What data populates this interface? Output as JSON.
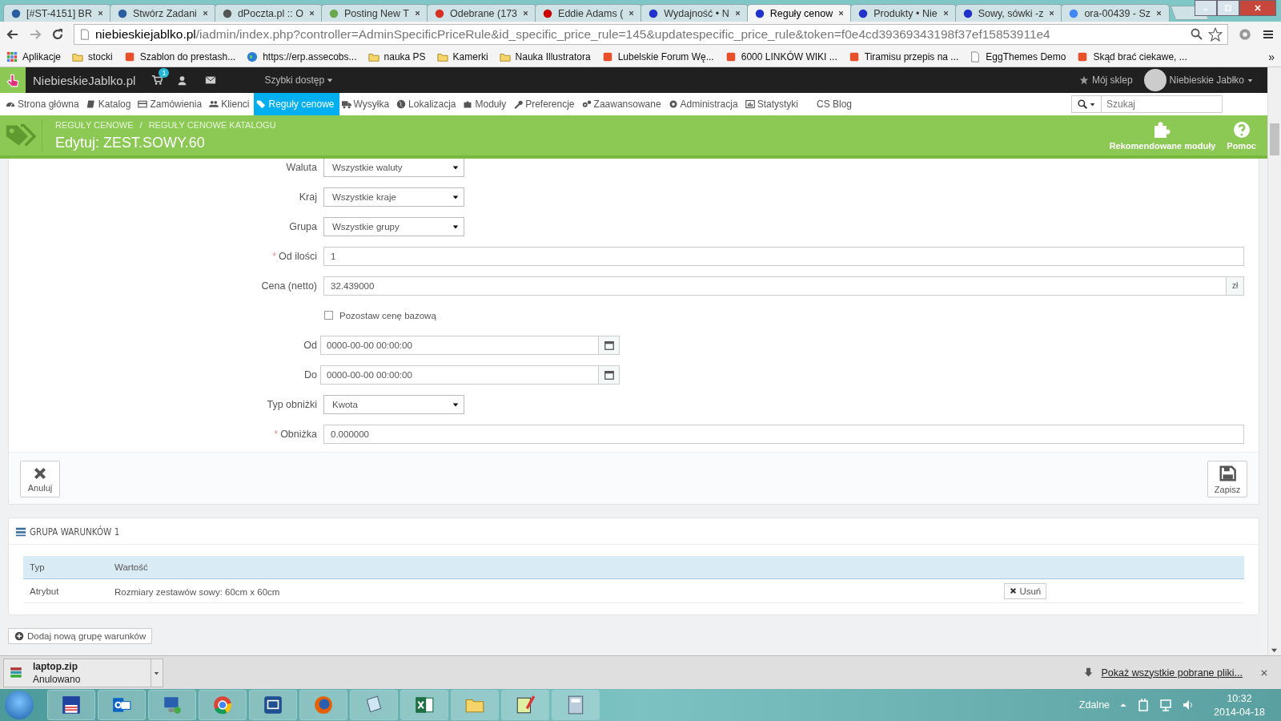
{
  "browser": {
    "tabs": [
      {
        "title": "[#ST-4151] BR",
        "selected": false
      },
      {
        "title": "Stwórz Zadani",
        "selected": false
      },
      {
        "title": "dPoczta.pl :: O",
        "selected": false
      },
      {
        "title": "Posting New T",
        "selected": false
      },
      {
        "title": "Odebrane (173",
        "selected": false
      },
      {
        "title": "Eddie Adams (",
        "selected": false
      },
      {
        "title": "Wydajność • N",
        "selected": false
      },
      {
        "title": "Reguły cenow",
        "selected": true
      },
      {
        "title": "Produkty • Nie",
        "selected": false
      },
      {
        "title": "Sowy, sówki -z",
        "selected": false
      },
      {
        "title": "ora-00439 - Sz",
        "selected": false
      }
    ],
    "address": {
      "domain": "niebieskiejablko.pl",
      "path": "/iadmin/index.php?controller=AdminSpecificPriceRule&id_specific_price_rule=145&updatespecific_price_rule&token=f0e4cd39369343198f37ef15853911e4"
    },
    "bookmarks": [
      {
        "label": "Aplikacje",
        "kind": "apps"
      },
      {
        "label": "stocki",
        "kind": "folder"
      },
      {
        "label": "Szablon do prestash...",
        "kind": "page"
      },
      {
        "label": "https://erp.assecobs...",
        "kind": "globe"
      },
      {
        "label": "nauka PS",
        "kind": "folder"
      },
      {
        "label": "Kamerki",
        "kind": "folder"
      },
      {
        "label": "Nauka Illustratora",
        "kind": "folder"
      },
      {
        "label": "Lubelskie Forum Wę...",
        "kind": "page"
      },
      {
        "label": "6000 LINKÓW WIKI ...",
        "kind": "page"
      },
      {
        "label": "Tiramisu przepis na ...",
        "kind": "page"
      },
      {
        "label": "EggThemes Demo",
        "kind": "doc"
      },
      {
        "label": "Skąd brać ciekawe, ...",
        "kind": "page"
      }
    ],
    "more": "»"
  },
  "admin": {
    "shop_name": "NiebieskieJablko.pl",
    "cart_badge": "1",
    "quick_access": "Szybki dostęp",
    "my_shop": "Mój sklep",
    "user": "Niebieskie Jabłko",
    "nav": [
      {
        "label": "Strona główna",
        "selected": false
      },
      {
        "label": "Katalog",
        "selected": false
      },
      {
        "label": "Zamówienia",
        "selected": false
      },
      {
        "label": "Klienci",
        "selected": false
      },
      {
        "label": "Reguły cenowe",
        "selected": true
      },
      {
        "label": "Wysyłka",
        "selected": false
      },
      {
        "label": "Lokalizacja",
        "selected": false
      },
      {
        "label": "Moduły",
        "selected": false
      },
      {
        "label": "Preferencje",
        "selected": false
      },
      {
        "label": "Zaawansowane",
        "selected": false
      },
      {
        "label": "Administracja",
        "selected": false
      },
      {
        "label": "Statystyki",
        "selected": false
      },
      {
        "label": "CS Blog",
        "selected": false
      }
    ],
    "search": {
      "placeholder": "Szukaj"
    },
    "breadcrumb": [
      "REGUŁY CENOWE",
      "REGUŁY CENOWE KATALOGU"
    ],
    "breadcrumb_separator": "/",
    "page_title": "Edytuj: ZEST.SOWY.60",
    "toolbar": [
      "Rekomendowane moduły",
      "Pomoc"
    ]
  },
  "form": {
    "fields": [
      {
        "kind": "select",
        "label": "Waluta",
        "required": false,
        "value": "Wszystkie waluty"
      },
      {
        "kind": "select",
        "label": "Kraj",
        "required": false,
        "value": "Wszystkie kraje"
      },
      {
        "kind": "select",
        "label": "Grupa",
        "required": false,
        "value": "Wszystkie grupy"
      },
      {
        "kind": "input",
        "label": "Od ilości",
        "required": true,
        "value": "1"
      },
      {
        "kind": "input",
        "label": "Cena (netto)",
        "required": false,
        "value": "32.439000",
        "suffix": "zł"
      },
      {
        "kind": "checkbox",
        "label": "Pozostaw cenę bazową",
        "checked": false
      },
      {
        "kind": "date",
        "label": "Od",
        "required": false,
        "value": "0000-00-00 00:00:00"
      },
      {
        "kind": "date",
        "label": "Do",
        "required": false,
        "value": "0000-00-00 00:00:00"
      },
      {
        "kind": "select",
        "label": "Typ obniżki",
        "required": false,
        "value": "Kwota"
      },
      {
        "kind": "input",
        "label": "Obniżka",
        "required": true,
        "value": "0.000000"
      }
    ],
    "required_mark": "*",
    "cancel": "Anuluj",
    "save": "Zapisz"
  },
  "conditions": {
    "title": "GRUPA WARUNKÓW 1",
    "columns": [
      "Typ",
      "Wartość"
    ],
    "rows": [
      {
        "type": "Atrybut",
        "value": "Rozmiary zestawów sowy: 60cm x 60cm",
        "action": "Usuń"
      }
    ],
    "add_button": "Dodaj nową grupę warunków"
  },
  "downloads": {
    "file": "laptop.zip",
    "status": "Anulowano",
    "show_all": "Pokaż wszystkie pobrane pliki..."
  },
  "taskbar": {
    "tray_label": "Zdalne",
    "time": "10:32",
    "date": "2014-04-18"
  }
}
